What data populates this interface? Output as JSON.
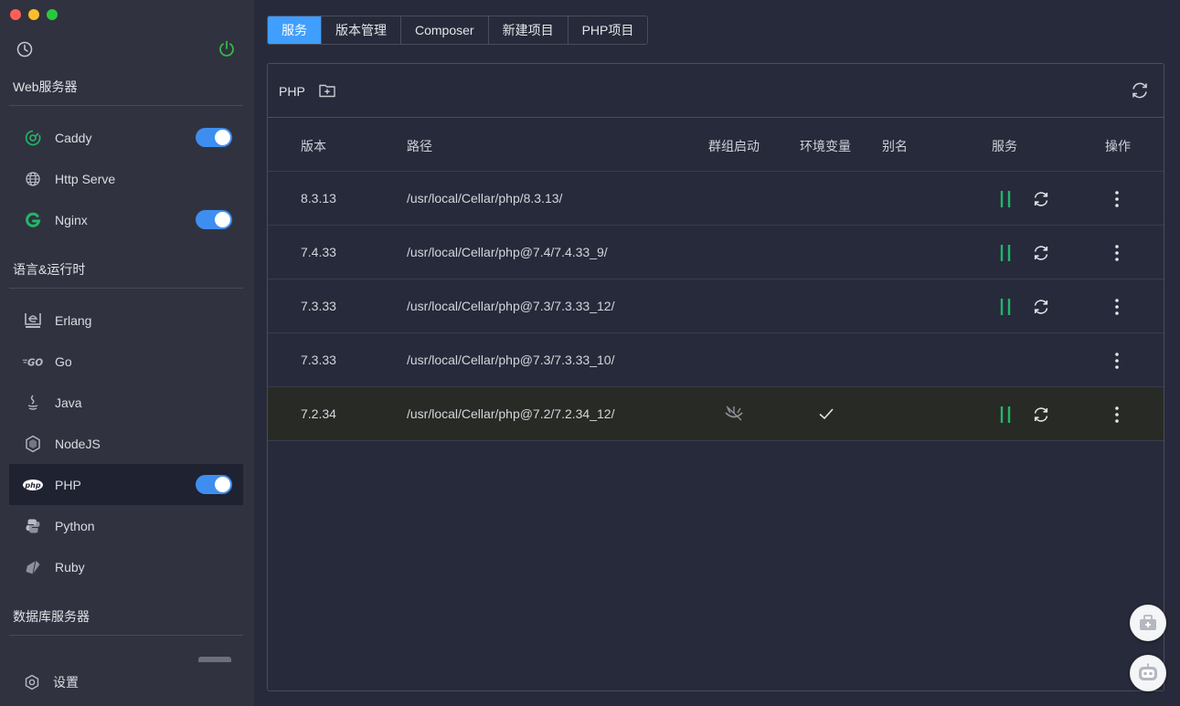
{
  "colors": {
    "accent": "#409eff",
    "toggle_on": "#3e8ef0",
    "service_green": "#1fb86a",
    "power_green": "#2fbf47"
  },
  "sidebar": {
    "sections": [
      {
        "title": "Web服务器",
        "items": [
          {
            "label": "Caddy",
            "icon": "caddy-icon",
            "toggle": true
          },
          {
            "label": "Http Serve",
            "icon": "globe-icon",
            "toggle": false
          },
          {
            "label": "Nginx",
            "icon": "nginx-icon",
            "toggle": true
          }
        ]
      },
      {
        "title": "语言&运行时",
        "items": [
          {
            "label": "Erlang",
            "icon": "erlang-icon",
            "toggle": false
          },
          {
            "label": "Go",
            "icon": "go-icon",
            "toggle": false
          },
          {
            "label": "Java",
            "icon": "java-icon",
            "toggle": false
          },
          {
            "label": "NodeJS",
            "icon": "nodejs-icon",
            "toggle": false
          },
          {
            "label": "PHP",
            "icon": "php-icon",
            "toggle": true,
            "active": true
          },
          {
            "label": "Python",
            "icon": "python-icon",
            "toggle": false
          },
          {
            "label": "Ruby",
            "icon": "ruby-icon",
            "toggle": false
          }
        ]
      },
      {
        "title": "数据库服务器",
        "items": []
      }
    ],
    "settings_label": "设置"
  },
  "tabs": [
    {
      "label": "服务",
      "active": true
    },
    {
      "label": "版本管理",
      "active": false
    },
    {
      "label": "Composer",
      "active": false
    },
    {
      "label": "新建项目",
      "active": false
    },
    {
      "label": "PHP项目",
      "active": false
    }
  ],
  "panel": {
    "title": "PHP",
    "columns": {
      "version": "版本",
      "path": "路径",
      "group": "群组启动",
      "env": "环境变量",
      "alias": "别名",
      "service": "服务",
      "ops": "操作"
    },
    "rows": [
      {
        "version": "8.3.13",
        "path": "/usr/local/Cellar/php/8.3.13/",
        "running": true,
        "group": false,
        "env": false
      },
      {
        "version": "7.4.33",
        "path": "/usr/local/Cellar/php@7.4/7.4.33_9/",
        "running": true,
        "group": false,
        "env": false
      },
      {
        "version": "7.3.33",
        "path": "/usr/local/Cellar/php@7.3/7.3.33_12/",
        "running": true,
        "group": false,
        "env": false
      },
      {
        "version": "7.3.33",
        "path": "/usr/local/Cellar/php@7.3/7.3.33_10/",
        "running": false,
        "group": false,
        "env": false
      },
      {
        "version": "7.2.34",
        "path": "/usr/local/Cellar/php@7.2/7.2.34_12/",
        "running": true,
        "group": true,
        "env": true,
        "highlight": true
      }
    ]
  }
}
